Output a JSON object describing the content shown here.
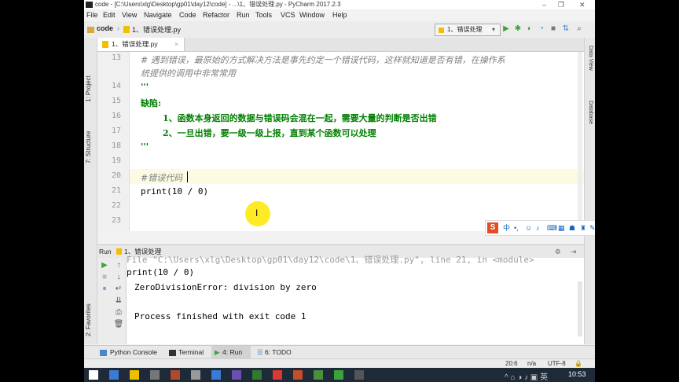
{
  "window": {
    "title": "code - [C:\\Users\\xlg\\Desktop\\gp01\\day12\\code] - ...\\1、错误处理.py - PyCharm 2017.2.3",
    "minimize": "–",
    "maximize": "❐",
    "close": "✕"
  },
  "menu": [
    "File",
    "Edit",
    "View",
    "Navigate",
    "Code",
    "Refactor",
    "Run",
    "Tools",
    "VCS",
    "Window",
    "Help"
  ],
  "breadcrumb": {
    "project": "code",
    "file": "1、错误处理.py"
  },
  "run_config": "1、错误处理",
  "file_tab": "1、错误处理.py",
  "left_tabs": {
    "project": "1: Project",
    "structure": "7: Structure",
    "favorites": "2: Favorites"
  },
  "right_tabs": {
    "data_view": "Data View",
    "database": "Database"
  },
  "editor": {
    "line_numbers": [
      "13",
      "14",
      "15",
      "16",
      "17",
      "18",
      "19",
      "20",
      "21",
      "22",
      "23"
    ],
    "comment_line1": "# 遇到错误，最原始的方式解决方法是事先约定一个错误代码，这样就知道是否有错，在操作系",
    "comment_line2": "统提供的调用中非常常用",
    "docstring_open": "'''",
    "doc_heading": "缺陷:",
    "doc_item1": "1、函数本身返回的数据与错误码会混在一起，需要大量的判断是否出错",
    "doc_item2": "2、一旦出错，要一级一级上报，直到某个函数可以处理",
    "docstring_close": "'''",
    "comment_line20": "#错误代码",
    "code_line21": "print(10 / 0)"
  },
  "ime_toolbar": {
    "logo": "S",
    "lang": "中"
  },
  "run_panel": {
    "label": "Run",
    "tab": "1、错误处理",
    "settings_icon": "⚙",
    "hide_icon": "⇥"
  },
  "console": {
    "line_partial": "  File \"C:\\Users\\xlg\\Desktop\\gp01\\day12\\code\\1、错误处理.py\", line 21, in <module>",
    "line_code": "    print(10 / 0)",
    "line_error": "ZeroDivisionError: division by zero",
    "line_exit": "Process finished with exit code 1"
  },
  "bottom_tabs": [
    "Python Console",
    "Terminal",
    "4: Run",
    "6: TODO"
  ],
  "status": {
    "position": "20:6",
    "separator": "n/a",
    "encoding": "UTF-8"
  },
  "taskbar": {
    "time": "10:53"
  },
  "colors": {
    "accent": "#4a86c8",
    "comment": "#808080",
    "docstring": "#008000",
    "run_green": "#3aa33a",
    "ime_red": "#e34c26"
  }
}
